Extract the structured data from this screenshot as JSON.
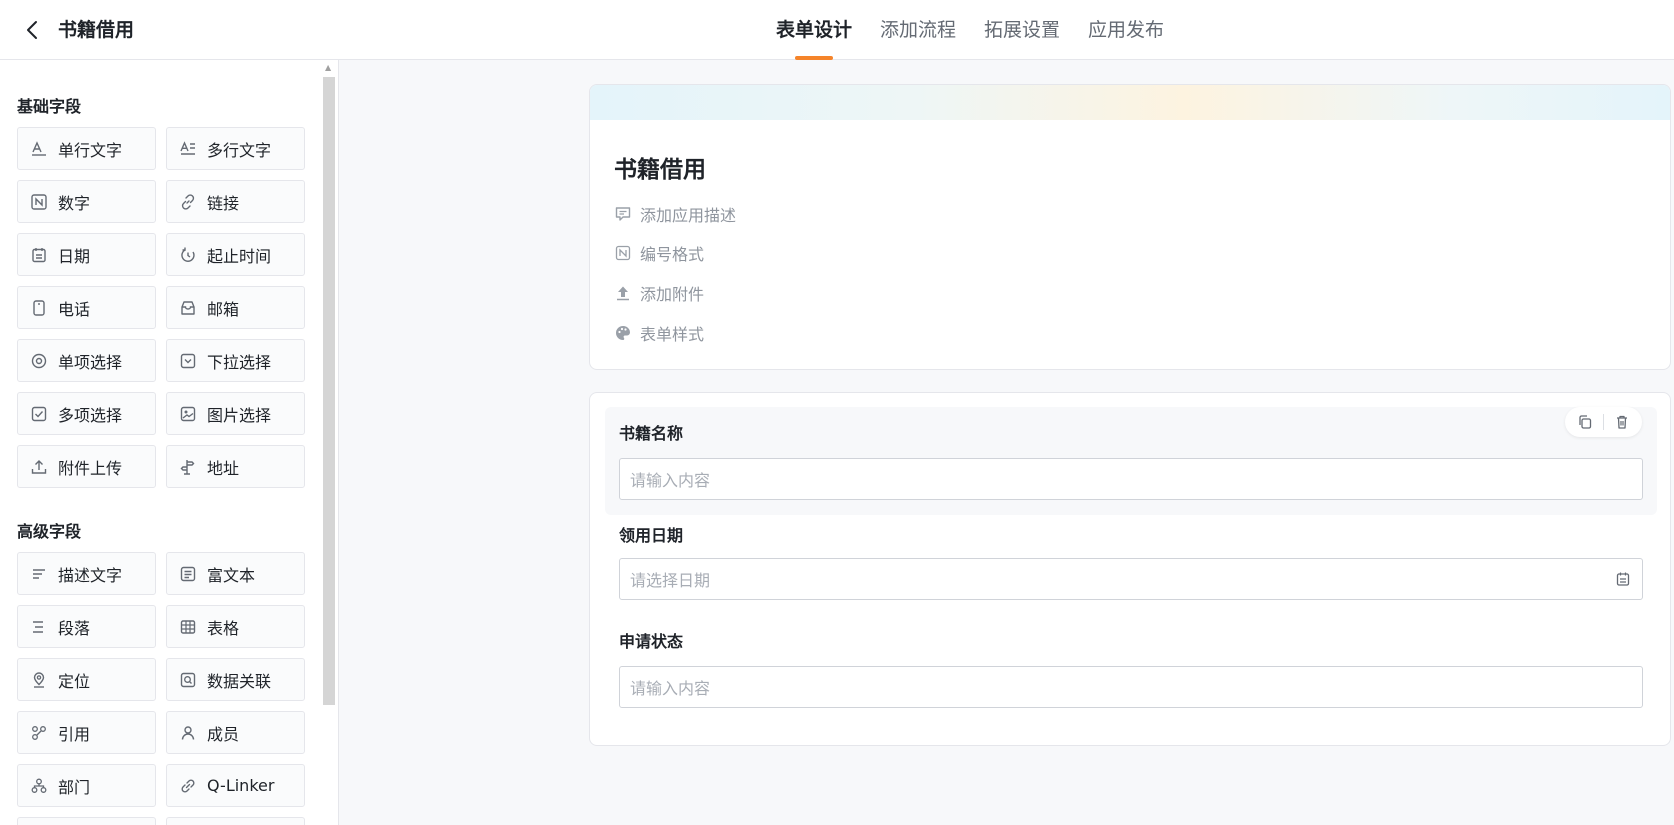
{
  "header": {
    "title": "书籍借用",
    "tabs": [
      {
        "label": "表单设计",
        "active": true
      },
      {
        "label": "添加流程",
        "active": false
      },
      {
        "label": "拓展设置",
        "active": false
      },
      {
        "label": "应用发布",
        "active": false
      }
    ]
  },
  "sidebar": {
    "basic_title": "基础字段",
    "basic_fields": [
      {
        "label": "单行文字",
        "icon": "single-line-text-icon"
      },
      {
        "label": "多行文字",
        "icon": "multi-line-text-icon"
      },
      {
        "label": "数字",
        "icon": "number-icon"
      },
      {
        "label": "链接",
        "icon": "link-icon"
      },
      {
        "label": "日期",
        "icon": "calendar-icon"
      },
      {
        "label": "起止时间",
        "icon": "time-range-icon"
      },
      {
        "label": "电话",
        "icon": "phone-icon"
      },
      {
        "label": "邮箱",
        "icon": "mailbox-icon"
      },
      {
        "label": "单项选择",
        "icon": "radio-icon"
      },
      {
        "label": "下拉选择",
        "icon": "dropdown-icon"
      },
      {
        "label": "多项选择",
        "icon": "checkbox-icon"
      },
      {
        "label": "图片选择",
        "icon": "image-icon"
      },
      {
        "label": "附件上传",
        "icon": "upload-icon"
      },
      {
        "label": "地址",
        "icon": "signpost-icon"
      }
    ],
    "advanced_title": "高级字段",
    "advanced_fields": [
      {
        "label": "描述文字",
        "icon": "description-text-icon"
      },
      {
        "label": "富文本",
        "icon": "rich-text-icon"
      },
      {
        "label": "段落",
        "icon": "paragraph-icon"
      },
      {
        "label": "表格",
        "icon": "table-icon"
      },
      {
        "label": "定位",
        "icon": "location-pin-icon"
      },
      {
        "label": "数据关联",
        "icon": "data-association-icon"
      },
      {
        "label": "引用",
        "icon": "reference-icon"
      },
      {
        "label": "成员",
        "icon": "member-icon"
      },
      {
        "label": "部门",
        "icon": "department-icon"
      },
      {
        "label": "Q-Linker",
        "icon": "q-linker-icon"
      }
    ]
  },
  "form": {
    "title": "书籍借用",
    "meta": [
      {
        "label": "添加应用描述",
        "icon": "comment-icon"
      },
      {
        "label": "编号格式",
        "icon": "number-format-icon"
      },
      {
        "label": "添加附件",
        "icon": "upload-arrow-icon"
      },
      {
        "label": "表单样式",
        "icon": "palette-icon"
      }
    ],
    "fields": [
      {
        "label": "书籍名称",
        "placeholder": "请输入内容"
      },
      {
        "label": "领用日期",
        "placeholder": "请选择日期"
      },
      {
        "label": "申请状态",
        "placeholder": "请输入内容"
      }
    ]
  }
}
